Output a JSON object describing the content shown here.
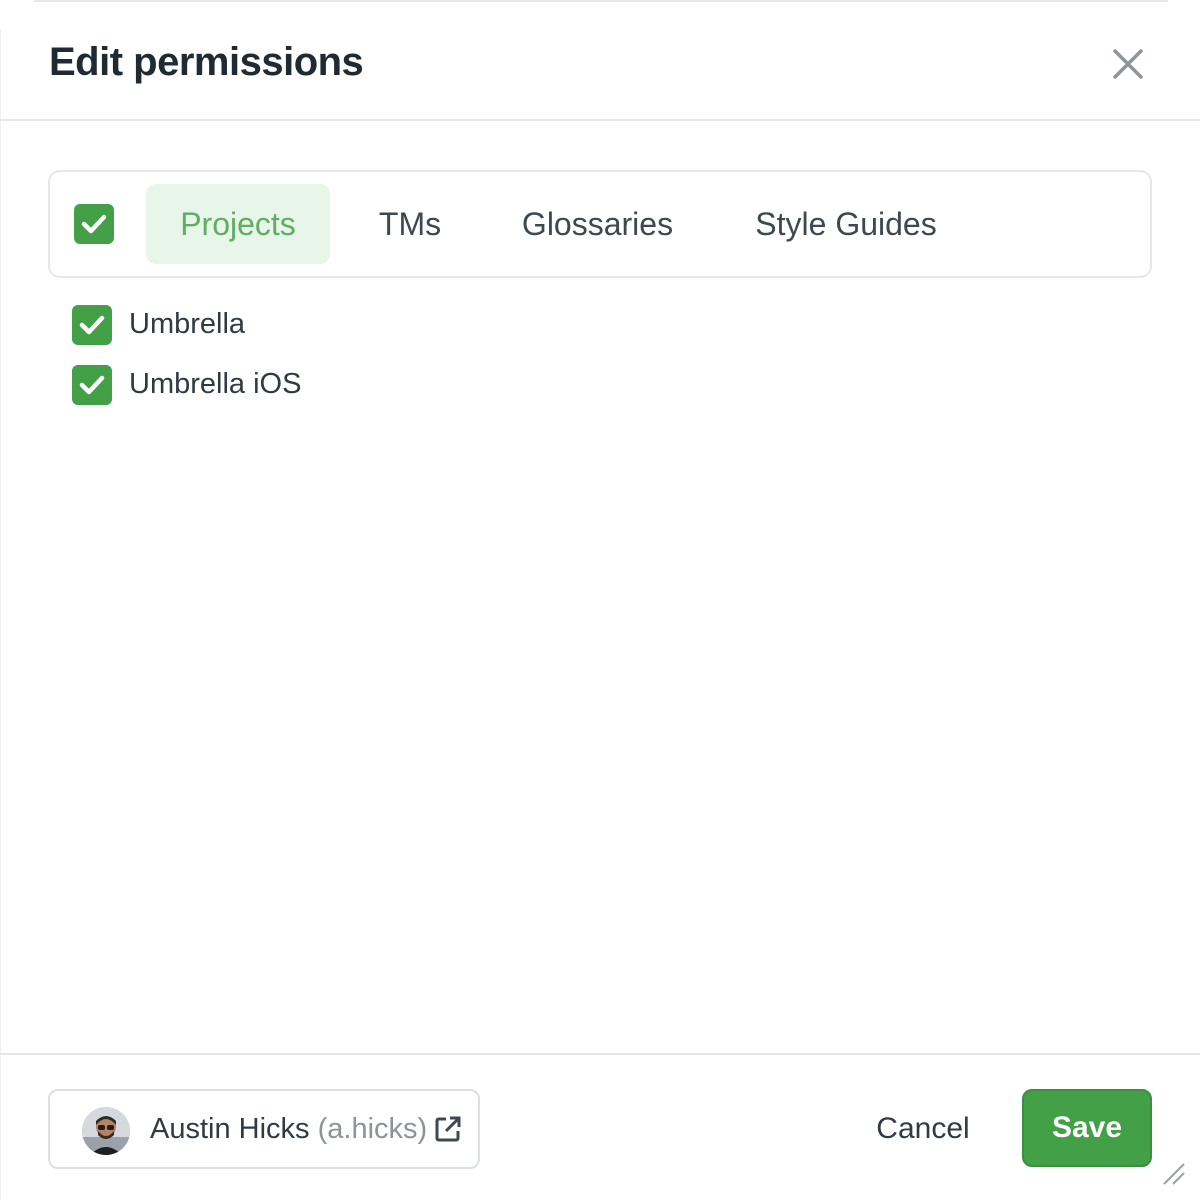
{
  "dialog": {
    "title": "Edit permissions",
    "close_icon": "close-icon"
  },
  "tabs": {
    "select_all_checked": true,
    "items": [
      {
        "label": "Projects",
        "active": true
      },
      {
        "label": "TMs",
        "active": false
      },
      {
        "label": "Glossaries",
        "active": false
      },
      {
        "label": "Style Guides",
        "active": false
      }
    ]
  },
  "items": [
    {
      "label": "Umbrella",
      "checked": true
    },
    {
      "label": "Umbrella iOS",
      "checked": true
    }
  ],
  "footer": {
    "user": {
      "name": "Austin Hicks",
      "handle": "(a.hicks)",
      "avatar_icon": "avatar",
      "link_icon": "external-link-icon"
    },
    "cancel_label": "Cancel",
    "save_label": "Save"
  },
  "colors": {
    "accent": "#43a047",
    "active_tab_bg": "#e8f5e9",
    "active_tab_text": "#5fae62"
  }
}
